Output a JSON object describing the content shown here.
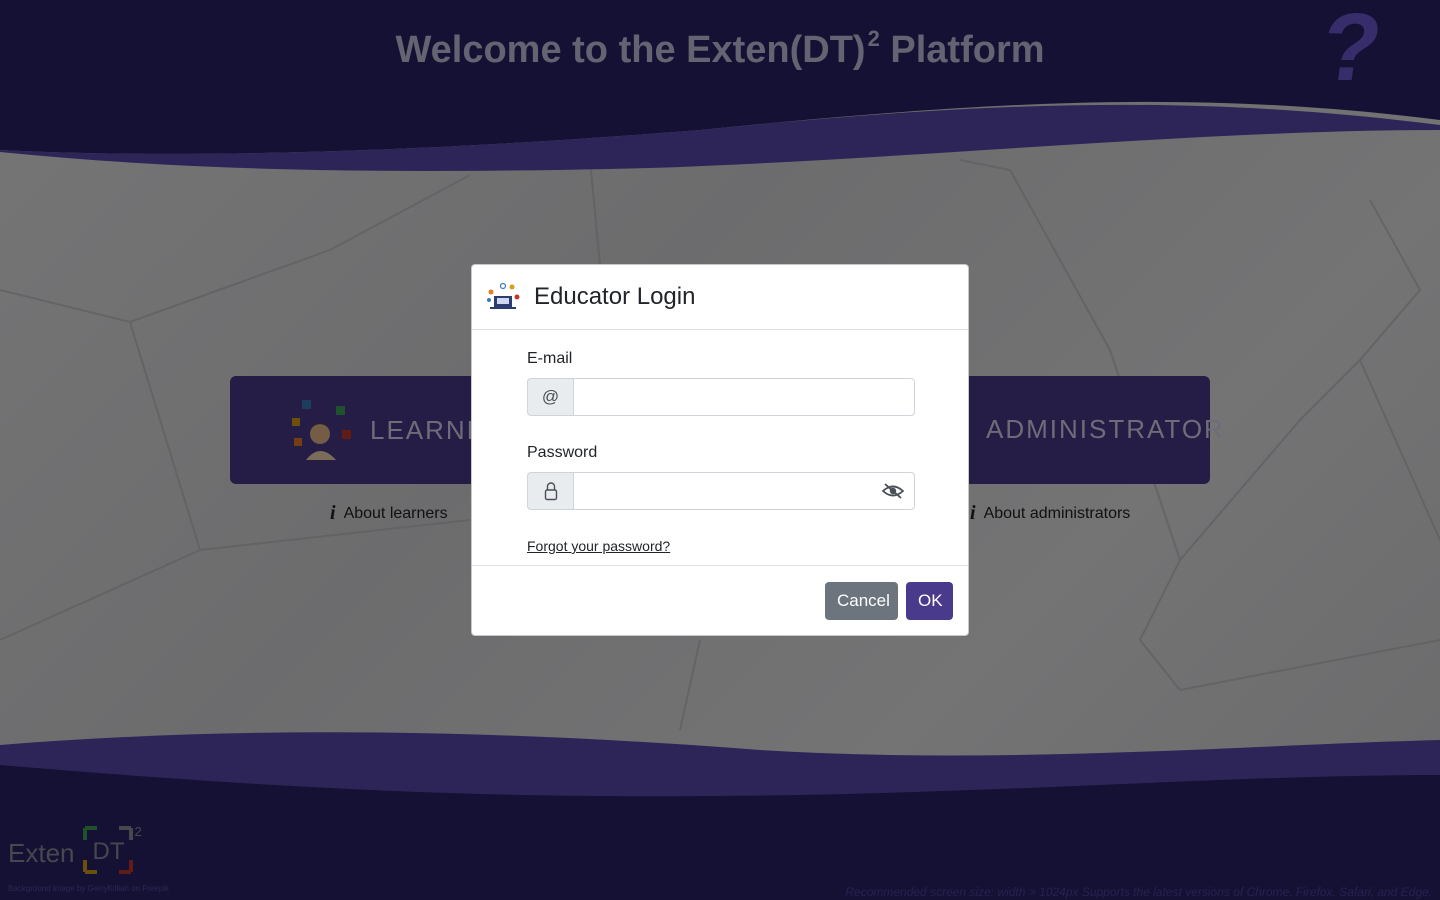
{
  "header": {
    "title": "Welcome to the Exten(DT)",
    "title_sup": "2",
    "title_suffix": " Platform",
    "help_glyph": "?"
  },
  "roles": {
    "learner_label": "LEARNER",
    "admin_label": "ADMINISTRATOR",
    "about_learners": "About learners",
    "about_admins": "About administrators",
    "info_glyph": "i"
  },
  "modal": {
    "title": "Educator Login",
    "email_label": "E-mail",
    "email_addon": "@",
    "email_value": "",
    "password_label": "Password",
    "password_value": "",
    "forgot_link": "Forgot your password?",
    "cancel_label": "Cancel",
    "ok_label": "OK"
  },
  "footer": {
    "logo_text": "Exten",
    "logo_dt": "DT",
    "logo_sup": "2",
    "credit": "Background image by GerryKillian on Freepik",
    "recommended": "Recommended screen size: width > 1024px Supports the latest versions of Chrome, Firefox, Safari, and Edge."
  },
  "colors": {
    "brand": "#4a3a8c",
    "header_bg": "#2a2368",
    "wave": "#5a4ab0",
    "cancel": "#6c757d"
  },
  "icons": [
    "help-icon",
    "learner-illustration-icon",
    "info-icon",
    "educator-icon",
    "at-icon",
    "lock-icon",
    "eye-slash-icon"
  ]
}
